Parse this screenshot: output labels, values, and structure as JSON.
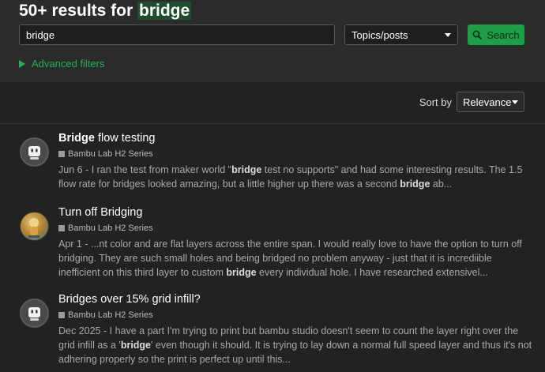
{
  "heading": {
    "prefix": "50+ results for",
    "term": "bridge"
  },
  "search": {
    "value": "bridge",
    "type": "Topics/posts",
    "button": "Search"
  },
  "advanced": {
    "label": "Advanced filters"
  },
  "sort": {
    "label": "Sort by",
    "value": "Relevance"
  },
  "results": [
    {
      "avatar": "robot-avatar",
      "title_parts": [
        [
          "Bridge",
          true
        ],
        [
          " flow testing",
          false
        ]
      ],
      "category": "Bambu Lab H2 Series",
      "date": "Jun 6",
      "excerpt_parts": [
        [
          " - I ran the test from maker world \"",
          false
        ],
        [
          "bridge",
          true
        ],
        [
          " test no supports\" and had some interesting results. The 1.5 flow rate for bridges looked amazing, but a little higher up there was a second ",
          false
        ],
        [
          "bridge",
          true
        ],
        [
          " ab...",
          false
        ]
      ]
    },
    {
      "avatar": "photo-avatar",
      "title_parts": [
        [
          "Turn off Bridging",
          false
        ]
      ],
      "category": "Bambu Lab H2 Series",
      "date": "Apr 1",
      "excerpt_parts": [
        [
          " - ...nt color and are flat layers across the entire span. I would really love to have the option to turn off bridging. They are such small holes and being bridged no problem anyway - just that it is incrediible inefficient on this third layer to custom ",
          false
        ],
        [
          "bridge",
          true
        ],
        [
          " every individual hole. I have researched extensivel...",
          false
        ]
      ]
    },
    {
      "avatar": "robot-avatar",
      "title_parts": [
        [
          "Bridges over 15% grid infill?",
          false
        ]
      ],
      "category": "Bambu Lab H2 Series",
      "date": "Dec 2025",
      "excerpt_parts": [
        [
          " - I have a part I'm trying to print but bambu studio doesn't seem to count the layer right over the grid infill as a '",
          false
        ],
        [
          "bridge",
          true
        ],
        [
          "' even though it should. It is trying to lay down a normal full speed layer and thus it's not adhering properly so the print is perfect up until this...",
          false
        ]
      ]
    }
  ],
  "colors": {
    "accent": "#1b9e45",
    "link": "#25b14f",
    "highlight": "#1e4d2b",
    "background": "#222222"
  }
}
